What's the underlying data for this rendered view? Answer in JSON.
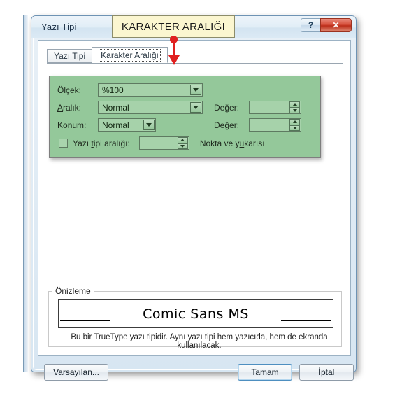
{
  "window": {
    "title": "Yazı Tipi",
    "help_button": "?",
    "close_button": "✕"
  },
  "tabs": [
    {
      "label": "Yazı Tipi",
      "active": false
    },
    {
      "label": "Karakter Aralığı",
      "active": true
    }
  ],
  "annotation": {
    "callout_text": "KARAKTER ARALIĞI",
    "color": "#e02020",
    "background": "#fbf6d0"
  },
  "spacing_panel": {
    "highlight_color": "#94c89a",
    "scale": {
      "label": "Ölçek:",
      "label_prefix": "Öl",
      "label_accel": "ç",
      "label_suffix": "ek:",
      "value": "%100"
    },
    "spacing": {
      "label": "Aralık:",
      "label_accel": "A",
      "label_suffix": "ralık:",
      "value": "Normal",
      "amount_label": "Değer:",
      "amount_prefix": "De",
      "amount_accel": "ğ",
      "amount_suffix": "er:",
      "amount_value": ""
    },
    "position": {
      "label": "Konum:",
      "label_accel": "K",
      "label_suffix": "onum:",
      "value": "Normal",
      "amount_label": "Değer:",
      "amount_prefix": "Değe",
      "amount_accel": "r",
      "amount_suffix": ":",
      "amount_value": ""
    },
    "kerning": {
      "checked": false,
      "label": "Yazı tipi aralığı:",
      "label_prefix": "Yazı ",
      "label_accel": "t",
      "label_suffix": "ipi aralığı:",
      "value": "",
      "suffix_prefix": "Nokta ve y",
      "suffix_accel": "u",
      "suffix_tail": "karısı",
      "suffix_label": "Nokta ve yukarısı"
    }
  },
  "preview": {
    "legend": "Önizleme",
    "sample_text": "Comic Sans MS",
    "description": "Bu bir TrueType yazı tipidir. Aynı yazı tipi hem yazıcıda, hem de ekranda kullanılacak."
  },
  "buttons": {
    "default": {
      "label": "Varsayılan...",
      "prefix": "V",
      "accel": "a",
      "suffix": "rsayılan..."
    },
    "ok": {
      "label": "Tamam"
    },
    "cancel": {
      "label": "İptal"
    }
  }
}
